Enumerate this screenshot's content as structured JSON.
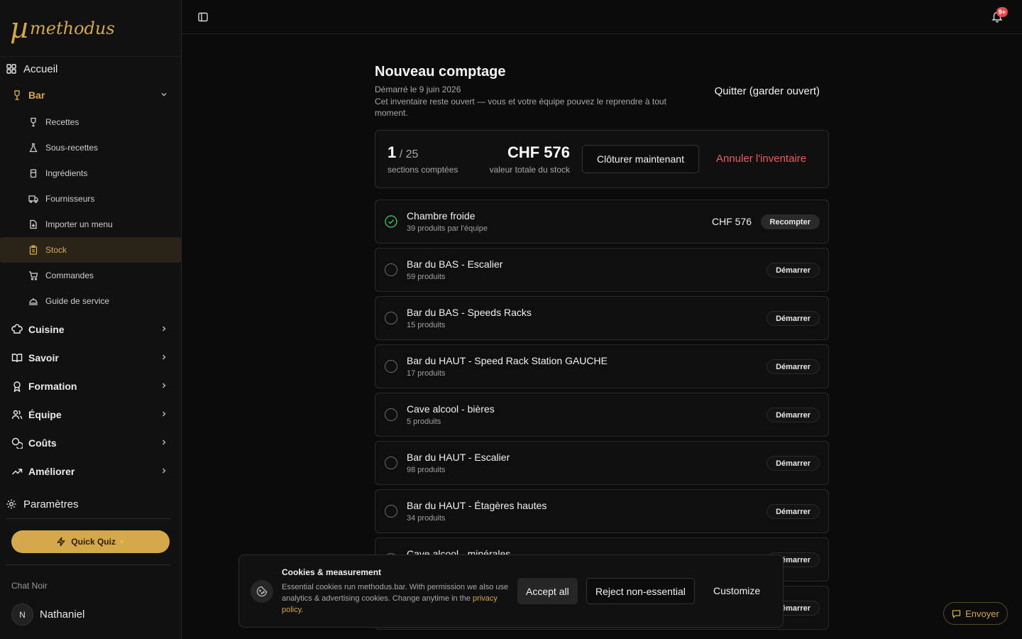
{
  "brand": {
    "mu": "µ",
    "word": "methodus"
  },
  "sidebar": {
    "home": "Accueil",
    "bar": {
      "label": "Bar",
      "items": [
        "Recettes",
        "Sous-recettes",
        "Ingrédients",
        "Fournisseurs",
        "Importer un menu",
        "Stock",
        "Commandes",
        "Guide de service"
      ]
    },
    "groups": [
      "Cuisine",
      "Savoir",
      "Formation",
      "Équipe",
      "Coûts",
      "Améliorer"
    ],
    "settings": "Paramètres",
    "quiz": "Quick Quiz",
    "quiz_bolt": "⚡",
    "org": "Chat Noir",
    "user_initial": "N",
    "user_name": "Nathaniel"
  },
  "topbar": {
    "badge": "9+"
  },
  "page": {
    "title": "Nouveau comptage",
    "started": "Démarré le 9 juin 2026",
    "desc": "Cet inventaire reste ouvert — vous et votre équipe pouvez le reprendre à tout moment.",
    "quit": "Quitter (garder ouvert)"
  },
  "summary": {
    "count": "1",
    "total": "/ 25",
    "count_label": "sections comptées",
    "value": "CHF 576",
    "value_label": "valeur totale du stock",
    "close": "Clôturer maintenant",
    "cancel": "Annuler l'inventaire"
  },
  "sections": [
    {
      "name": "Chambre froide",
      "meta": "39 produits   par l'équipe",
      "price": "CHF 576",
      "btn": "Recompter",
      "done": true
    },
    {
      "name": "Bar du BAS - Escalier",
      "meta": "59 produits",
      "btn": "Démarrer"
    },
    {
      "name": "Bar du BAS - Speeds Racks",
      "meta": "15 produits",
      "btn": "Démarrer"
    },
    {
      "name": "Bar du HAUT - Speed Rack Station GAUCHE",
      "meta": "17 produits",
      "btn": "Démarrer"
    },
    {
      "name": "Cave alcool - bières",
      "meta": "5 produits",
      "btn": "Démarrer"
    },
    {
      "name": "Bar du HAUT - Escalier",
      "meta": "98 produits",
      "btn": "Démarrer"
    },
    {
      "name": "Bar du HAUT - Étagères hautes",
      "meta": "34 produits",
      "btn": "Démarrer"
    },
    {
      "name": "Cave alcool - minérales",
      "meta": "",
      "btn": "Démarrer"
    },
    {
      "name": "",
      "meta": "",
      "btn": "Démarrer"
    }
  ],
  "cookie": {
    "title": "Cookies & measurement",
    "body": "Essential cookies run methodus.bar. With permission we also use analytics & advertising cookies. Change anytime in the",
    "link": "privacy policy.",
    "accept": "Accept all",
    "reject": "Reject non-essential",
    "customize": "Customize"
  },
  "send": "Envoyer",
  "colors": {
    "accent": "#d6a84c",
    "danger": "#e85d5d",
    "success": "#3fb26b"
  }
}
